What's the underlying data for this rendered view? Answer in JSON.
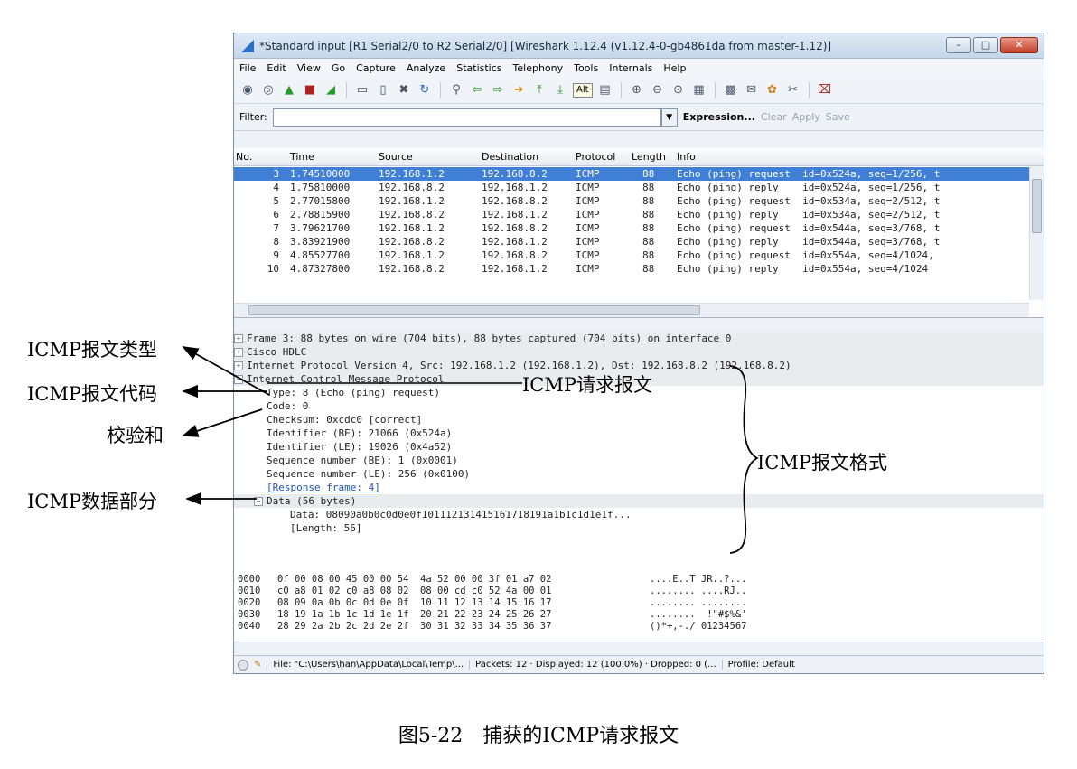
{
  "window": {
    "title": "*Standard input  [R1 Serial2/0 to R2 Serial2/0]  [Wireshark 1.12.4  (v1.12.4-0-gb4861da from master-1.12)]",
    "buttons": {
      "minimize": "–",
      "maximize": "□",
      "close": "✕"
    }
  },
  "menu": [
    "File",
    "Edit",
    "View",
    "Go",
    "Capture",
    "Analyze",
    "Statistics",
    "Telephony",
    "Tools",
    "Internals",
    "Help"
  ],
  "toolbar": {
    "tooltip": "Alt"
  },
  "filter": {
    "label": "Filter:",
    "value": "",
    "expression": "Expression...",
    "clear": "Clear",
    "apply": "Apply",
    "save": "Save"
  },
  "packet_list": {
    "columns": [
      "No.",
      "Time",
      "Source",
      "Destination",
      "Protocol",
      "Length",
      "Info"
    ],
    "rows": [
      [
        "3",
        "1.74510000",
        "192.168.1.2",
        "192.168.8.2",
        "ICMP",
        "88",
        "Echo (ping) request  id=0x524a, seq=1/256, t"
      ],
      [
        "4",
        "1.75810000",
        "192.168.8.2",
        "192.168.1.2",
        "ICMP",
        "88",
        "Echo (ping) reply    id=0x524a, seq=1/256, t"
      ],
      [
        "5",
        "2.77015800",
        "192.168.1.2",
        "192.168.8.2",
        "ICMP",
        "88",
        "Echo (ping) request  id=0x534a, seq=2/512, t"
      ],
      [
        "6",
        "2.78815900",
        "192.168.8.2",
        "192.168.1.2",
        "ICMP",
        "88",
        "Echo (ping) reply    id=0x534a, seq=2/512, t"
      ],
      [
        "7",
        "3.79621700",
        "192.168.1.2",
        "192.168.8.2",
        "ICMP",
        "88",
        "Echo (ping) request  id=0x544a, seq=3/768, t"
      ],
      [
        "8",
        "3.83921900",
        "192.168.8.2",
        "192.168.1.2",
        "ICMP",
        "88",
        "Echo (ping) reply    id=0x544a, seq=3/768, t"
      ],
      [
        "9",
        "4.85527700",
        "192.168.1.2",
        "192.168.8.2",
        "ICMP",
        "88",
        "Echo (ping) request  id=0x554a, seq=4/1024,"
      ],
      [
        "10",
        "4.87327800",
        "192.168.8.2",
        "192.168.1.2",
        "ICMP",
        "88",
        "Echo (ping) reply    id=0x554a, seq=4/1024"
      ]
    ]
  },
  "details": {
    "frame": "Frame 3: 88 bytes on wire (704 bits), 88 bytes captured (704 bits) on interface 0",
    "hdlc": "Cisco HDLC",
    "ip": "Internet Protocol Version 4, Src: 192.168.1.2 (192.168.1.2), Dst: 192.168.8.2 (192.168.8.2)",
    "icmp": "Internet Control Message Protocol",
    "fields": [
      "Type: 8 (Echo (ping) request)",
      "Code: 0",
      "Checksum: 0xcdc0 [correct]",
      "Identifier (BE): 21066 (0x524a)",
      "Identifier (LE): 19026 (0x4a52)",
      "Sequence number (BE): 1 (0x0001)",
      "Sequence number (LE): 256 (0x0100)"
    ],
    "response_link": "[Response frame: 4]",
    "data_header": "Data (56 bytes)",
    "data_value": "Data: 08090a0b0c0d0e0f101112131415161718191a1b1c1d1e1f...",
    "data_length": "[Length: 56]"
  },
  "hex": [
    [
      "0000",
      "0f 00 08 00 45 00 00 54  4a 52 00 00 3f 01 a7 02",
      "....E..T JR..?..."
    ],
    [
      "0010",
      "c0 a8 01 02 c0 a8 08 02  08 00 cd c0 52 4a 00 01",
      "........ ....RJ.."
    ],
    [
      "0020",
      "08 09 0a 0b 0c 0d 0e 0f  10 11 12 13 14 15 16 17",
      "........ ........"
    ],
    [
      "0030",
      "18 19 1a 1b 1c 1d 1e 1f  20 21 22 23 24 25 26 27",
      "........  !\"#$%&'"
    ],
    [
      "0040",
      "28 29 2a 2b 2c 2d 2e 2f  30 31 32 33 34 35 36 37",
      "()*+,-./ 01234567"
    ]
  ],
  "status": {
    "file": "File: \"C:\\Users\\han\\AppData\\Local\\Temp\\...",
    "packets": "Packets: 12 · Displayed: 12 (100.0%) · Dropped: 0 (...",
    "profile": "Profile: Default"
  },
  "annotations": {
    "type": "ICMP报文类型",
    "code": "ICMP报文代码",
    "checksum": "校验和",
    "data_part": "ICMP数据部分",
    "request": "ICMP请求报文",
    "format": "ICMP报文格式"
  },
  "caption": "图5-22　捕获的ICMP请求报文"
}
